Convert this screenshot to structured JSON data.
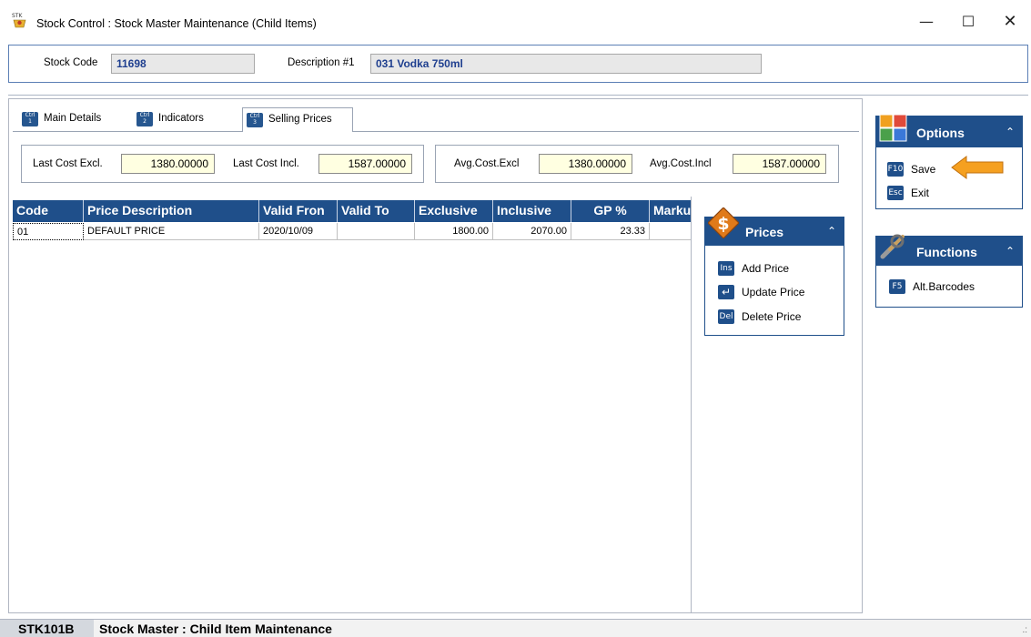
{
  "window": {
    "title": "Stock Control : Stock Master Maintenance (Child Items)",
    "minimize_glyph": "—",
    "maximize_glyph": "☐",
    "close_glyph": "✕"
  },
  "header": {
    "stock_code_label": "Stock Code",
    "stock_code_value": "11698",
    "description_label": "Description #1",
    "description_value": "031 Vodka 750ml"
  },
  "tabs": [
    {
      "label": "Main Details",
      "key": "Ctrl 1"
    },
    {
      "label": "Indicators",
      "key": "Ctrl 2"
    },
    {
      "label": "Selling Prices",
      "key": "Ctrl 3"
    }
  ],
  "costs": {
    "last_cost_excl_label": "Last Cost Excl.",
    "last_cost_excl_value": "1380.00000",
    "last_cost_incl_label": "Last Cost Incl.",
    "last_cost_incl_value": "1587.00000",
    "avg_cost_excl_label": "Avg.Cost.Excl",
    "avg_cost_excl_value": "1380.00000",
    "avg_cost_incl_label": "Avg.Cost.Incl",
    "avg_cost_incl_value": "1587.00000"
  },
  "grid": {
    "columns": [
      "Code",
      "Price Description",
      "Valid Fron",
      "Valid To",
      "Exclusive",
      "Inclusive",
      "GP %",
      "Marku"
    ],
    "rows": [
      {
        "code": "01",
        "description": "DEFAULT PRICE",
        "valid_from": "2020/10/09",
        "valid_to": "",
        "exclusive": "1800.00",
        "inclusive": "2070.00",
        "gp": "23.33",
        "markup": ""
      }
    ]
  },
  "prices_panel": {
    "title": "Prices",
    "items": [
      {
        "key": "Ins",
        "label": "Add Price"
      },
      {
        "key": "↵",
        "label": "Update Price"
      },
      {
        "key": "Del",
        "label": "Delete Price"
      }
    ]
  },
  "options_panel": {
    "title": "Options",
    "items": [
      {
        "key": "F10",
        "label": "Save"
      },
      {
        "key": "Esc",
        "label": "Exit"
      }
    ]
  },
  "functions_panel": {
    "title": "Functions",
    "items": [
      {
        "key": "F5",
        "label": "Alt.Barcodes"
      }
    ]
  },
  "status": {
    "code": "STK101B",
    "text": "Stock Master : Child Item Maintenance"
  },
  "colors": {
    "panel_blue": "#1f4f8a",
    "highlight_arrow": "#f5a020",
    "field_yellow": "#ffffe1"
  }
}
